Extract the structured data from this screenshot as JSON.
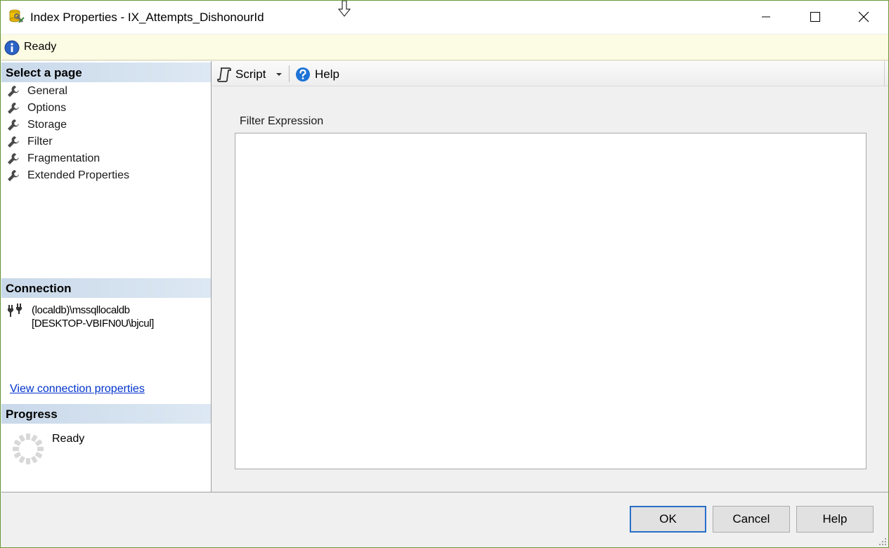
{
  "window": {
    "title": "Index Properties - IX_Attempts_DishonourId"
  },
  "status": {
    "text": "Ready"
  },
  "left_pane": {
    "select_page_header": "Select a page",
    "pages": [
      {
        "label": "General"
      },
      {
        "label": "Options"
      },
      {
        "label": "Storage"
      },
      {
        "label": "Filter",
        "selected": true
      },
      {
        "label": "Fragmentation"
      },
      {
        "label": "Extended Properties"
      }
    ],
    "connection_header": "Connection",
    "connection": {
      "server": "(localdb)\\mssqllocaldb",
      "user": "[DESKTOP-VBIFN0U\\bjcul]",
      "link": "View connection properties"
    },
    "progress_header": "Progress",
    "progress_status": "Ready"
  },
  "toolbar": {
    "script_label": "Script",
    "help_label": "Help"
  },
  "filter": {
    "label": "Filter Expression",
    "value": ""
  },
  "footer": {
    "ok_label": "OK",
    "cancel_label": "Cancel",
    "help_label": "Help"
  },
  "colors": {
    "status_bg": "#fcfbe3",
    "section_header": "#c9d9ea",
    "link": "#0033cc",
    "ok_border": "#2a6fc9",
    "window_border": "#6a9a3a"
  }
}
